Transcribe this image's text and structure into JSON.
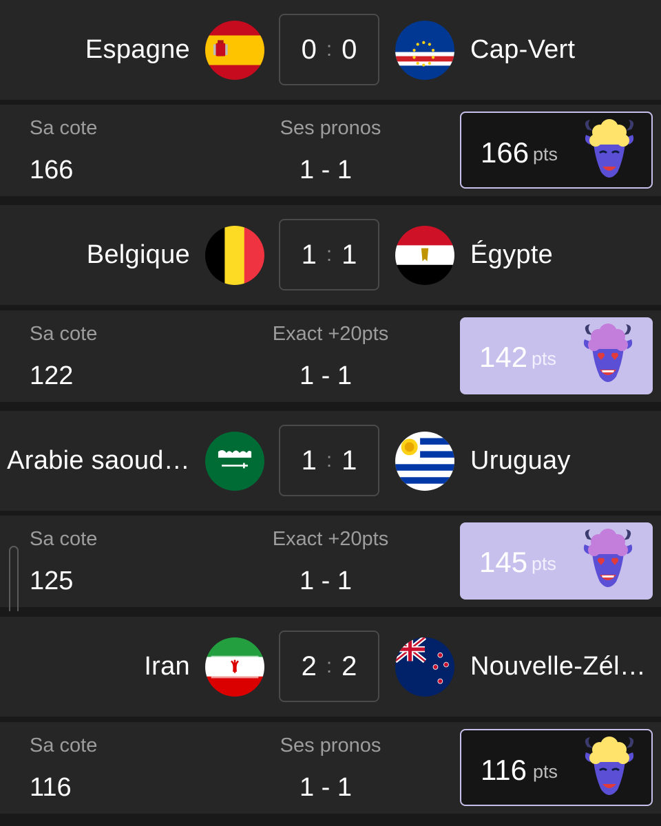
{
  "matches": [
    {
      "home": {
        "name": "Espagne",
        "flag": "spain-flag"
      },
      "away": {
        "name": "Cap-Vert",
        "flag": "cape-verde-flag"
      },
      "score": {
        "home": "0",
        "sep": ":",
        "away": "0"
      },
      "prediction": {
        "cote_label": "Sa cote",
        "cote_value": "166",
        "pronos_label": "Ses pronos",
        "pronos_value": "1 - 1",
        "points": "166",
        "points_unit": "pts",
        "card_style": "dark",
        "avatar": "yellow-goat-avatar-icon"
      }
    },
    {
      "home": {
        "name": "Belgique",
        "flag": "belgium-flag"
      },
      "away": {
        "name": "Égypte",
        "flag": "egypt-flag"
      },
      "score": {
        "home": "1",
        "sep": ":",
        "away": "1"
      },
      "prediction": {
        "cote_label": "Sa cote",
        "cote_value": "122",
        "pronos_label": "Exact +20pts",
        "pronos_value": "1 - 1",
        "points": "142",
        "points_unit": "pts",
        "card_style": "light",
        "avatar": "purple-goat-heart-eyes-avatar-icon"
      }
    },
    {
      "home": {
        "name": "Arabie saoud…",
        "flag": "saudi-arabia-flag"
      },
      "away": {
        "name": "Uruguay",
        "flag": "uruguay-flag"
      },
      "score": {
        "home": "1",
        "sep": ":",
        "away": "1"
      },
      "prediction": {
        "cote_label": "Sa cote",
        "cote_value": "125",
        "pronos_label": "Exact +20pts",
        "pronos_value": "1 - 1",
        "points": "145",
        "points_unit": "pts",
        "card_style": "light",
        "avatar": "purple-goat-heart-eyes-avatar-icon"
      }
    },
    {
      "home": {
        "name": "Iran",
        "flag": "iran-flag"
      },
      "away": {
        "name": "Nouvelle-Zél…",
        "flag": "new-zealand-flag"
      },
      "score": {
        "home": "2",
        "sep": ":",
        "away": "2"
      },
      "prediction": {
        "cote_label": "Sa cote",
        "cote_value": "116",
        "pronos_label": "Ses pronos",
        "pronos_value": "1 - 1",
        "points": "116",
        "points_unit": "pts",
        "card_style": "dark",
        "avatar": "yellow-goat-avatar-icon"
      }
    }
  ],
  "colors": {
    "background": "#191919",
    "row": "#262626",
    "label": "#9d9d9d",
    "card_border": "#c5bfe9",
    "card_light": "#c8c0ec"
  }
}
